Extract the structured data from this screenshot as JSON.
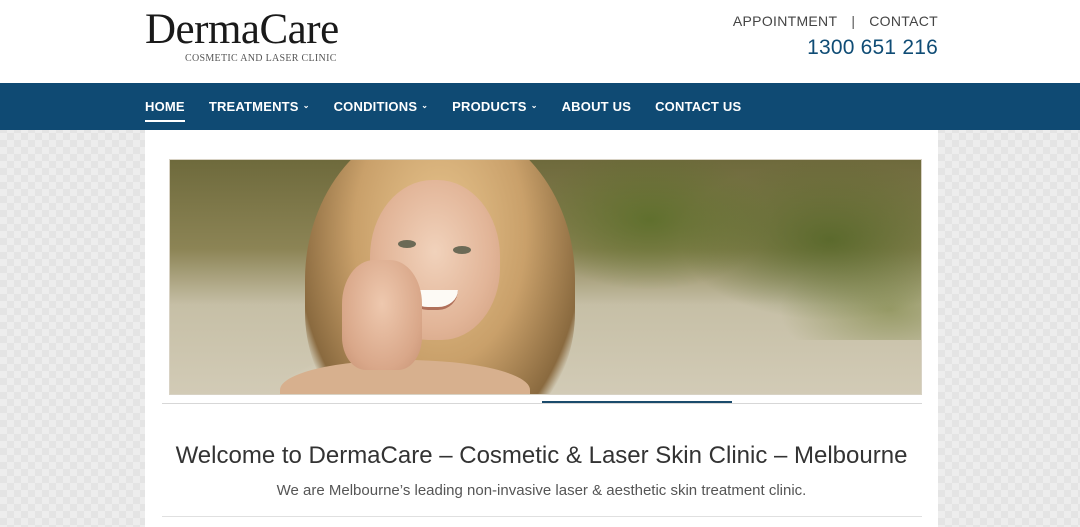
{
  "brand": {
    "name": "DermaCare",
    "tagline": "COSMETIC AND LASER CLINIC"
  },
  "top_links": {
    "appointment": "APPOINTMENT",
    "separator": "|",
    "contact": "CONTACT"
  },
  "phone": "1300 651 216",
  "nav": {
    "items": [
      {
        "label": "HOME",
        "active": true,
        "has_dropdown": false
      },
      {
        "label": "TREATMENTS",
        "active": false,
        "has_dropdown": true
      },
      {
        "label": "CONDITIONS",
        "active": false,
        "has_dropdown": true
      },
      {
        "label": "PRODUCTS",
        "active": false,
        "has_dropdown": true
      },
      {
        "label": "ABOUT US",
        "active": false,
        "has_dropdown": false
      },
      {
        "label": "CONTACT US",
        "active": false,
        "has_dropdown": false
      }
    ],
    "caret": "⌄"
  },
  "hero": {
    "image": "smiling-woman-hero-photo"
  },
  "welcome": {
    "title": "Welcome to DermaCare – Cosmetic & Laser Skin Clinic – Melbourne",
    "subtitle": "We are Melbourne’s leading non-invasive laser & aesthetic skin treatment clinic."
  },
  "colors": {
    "nav_bg": "#0f4a73",
    "phone": "#0f4c75",
    "slider_active": "#1b4b6c"
  }
}
